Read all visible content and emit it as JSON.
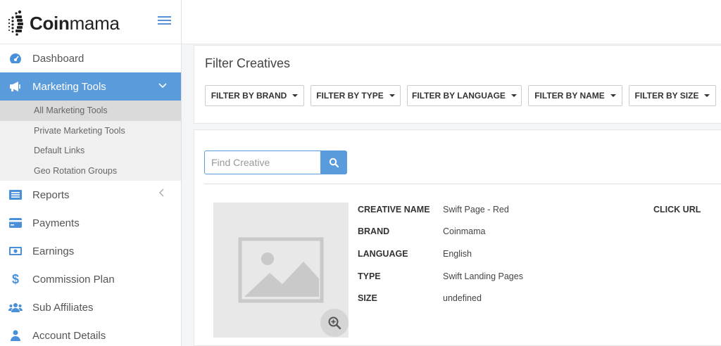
{
  "brand": {
    "name_bold": "Coin",
    "name_rest": "mama"
  },
  "nav": {
    "dashboard": "Dashboard",
    "marketing_tools": "Marketing Tools",
    "sub": [
      "All Marketing Tools",
      "Private Marketing Tools",
      "Default Links",
      "Geo Rotation Groups"
    ],
    "reports": "Reports",
    "payments": "Payments",
    "earnings": "Earnings",
    "commission_plan": "Commission Plan",
    "sub_affiliates": "Sub Affiliates",
    "account_details": "Account Details"
  },
  "filters": {
    "title": "Filter Creatives",
    "brand": "FILTER BY BRAND",
    "type": "FILTER BY TYPE",
    "language": "FILTER BY LANGUAGE",
    "name": "FILTER BY NAME",
    "size": "FILTER BY SIZE"
  },
  "search": {
    "placeholder": "Find Creative"
  },
  "creative": {
    "labels": {
      "name": "CREATIVE NAME",
      "brand": "BRAND",
      "language": "LANGUAGE",
      "type": "TYPE",
      "size": "SIZE",
      "click_url": "CLICK URL"
    },
    "values": {
      "name": "Swift Page - Red",
      "brand": "Coinmama",
      "language": "English",
      "type": "Swift Landing Pages",
      "size": "undefined"
    }
  },
  "colors": {
    "accent": "#5a9bdc",
    "nav_icon": "#4a90d9"
  }
}
